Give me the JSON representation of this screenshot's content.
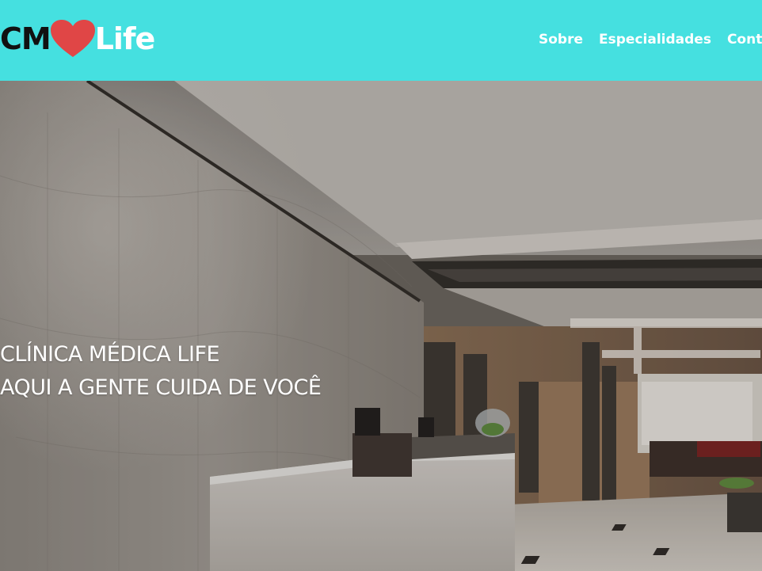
{
  "header": {
    "logo": {
      "part1": "CM",
      "heart": "heart-icon",
      "part2": "Life"
    },
    "nav": [
      {
        "label": "Sobre"
      },
      {
        "label": "Especialidades"
      },
      {
        "label": "Contato"
      }
    ]
  },
  "hero": {
    "line1": "CLÍNICA MÉDICA LIFE",
    "line2": "AQUI A GENTE CUIDA DE VOCÊ",
    "background": "clinic-lobby-image"
  },
  "colors": {
    "header_bg": "#45e0e0",
    "heart": "#e04646",
    "text_light": "#ffffff",
    "text_dark": "#111111"
  }
}
